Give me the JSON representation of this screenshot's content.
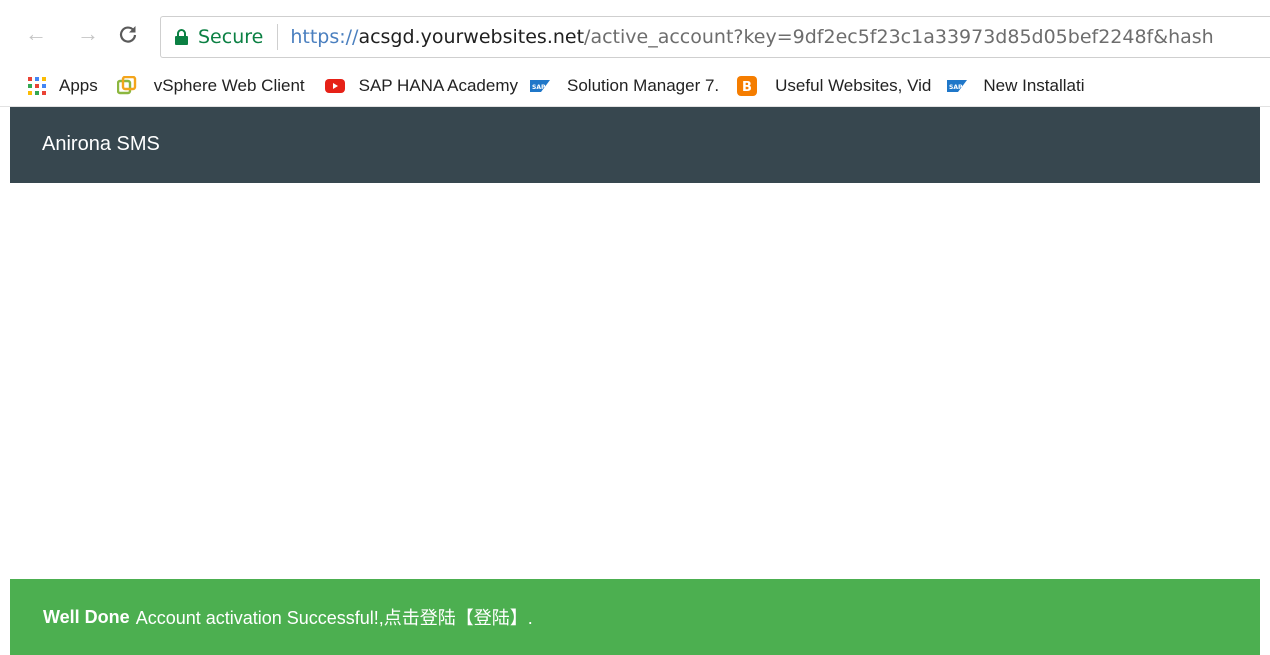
{
  "browser": {
    "address_bar": {
      "secure_label": "Secure",
      "url_scheme": "https://",
      "url_host": "acsgd.yourwebsites.net",
      "url_path": "/active_account?key=9df2ec5f23c1a33973d85d05bef2248f&hash"
    },
    "bookmarks": [
      {
        "label": "Apps",
        "icon": "apps-grid-icon"
      },
      {
        "label": "vSphere Web Client",
        "icon": "vsphere-icon"
      },
      {
        "label": "SAP HANA Academy",
        "icon": "youtube-icon"
      },
      {
        "label": "Solution Manager 7.",
        "icon": "sap-icon"
      },
      {
        "label": "Useful Websites, Vid",
        "icon": "blogger-icon"
      },
      {
        "label": "New Installati",
        "icon": "sap-icon"
      }
    ]
  },
  "header": {
    "brand": "Anirona SMS"
  },
  "alert": {
    "strong": "Well Done",
    "message": "Account activation Successful!,点击登陆【登陆】."
  },
  "colors": {
    "header_bg": "#37474f",
    "alert_bg": "#4caf50",
    "secure_green": "#0b8043"
  }
}
